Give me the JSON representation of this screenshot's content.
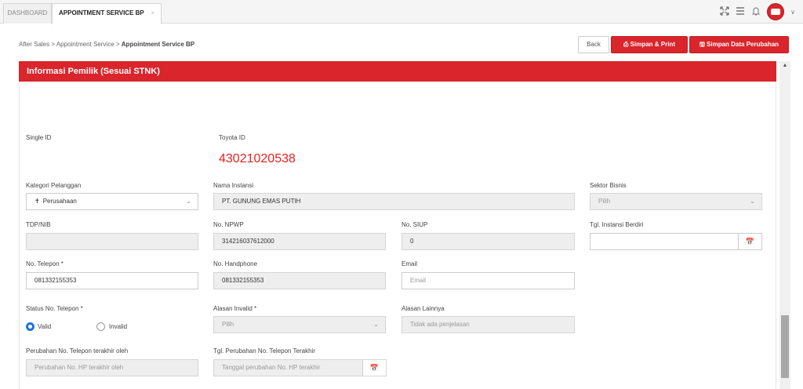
{
  "tabs": [
    {
      "label": "DASHBOARD",
      "active": false
    },
    {
      "label": "APPOINTMENT SERVICE BP",
      "active": true,
      "close": "×"
    }
  ],
  "topbar": {
    "icons": [
      "expand-icon",
      "menu-icon",
      "bell-icon",
      "avatar",
      "chevron-down-icon"
    ]
  },
  "breadcrumb": {
    "part1": "After Sales",
    "sep1": " > ",
    "part2": "Appointment Service",
    "sep2": " > ",
    "current": "Appointment Service BP"
  },
  "actions": {
    "back": "Back",
    "print": "Simpan & Print",
    "save": "Simpan Data Perubahan"
  },
  "section": {
    "title": "Informasi Pemilik (Sesuai STNK)"
  },
  "form": {
    "single_id_label": "Single ID",
    "toyota_id_label": "Toyota ID",
    "toyota_id_value": "43021020538",
    "kategori_label": "Kategori Pelanggan",
    "kategori_value": "Perusahaan",
    "nama_instansi_label": "Nama Instansi",
    "nama_instansi_value": "PT. GUNUNG EMAS PUTIH",
    "sektor_label": "Sektor Bisnis",
    "sektor_placeholder": "Pilih",
    "tdp_label": "TDP/NIB",
    "npwp_label": "No. NPWP",
    "npwp_value": "314216037612000",
    "siup_label": "No. SIUP",
    "siup_value": "0",
    "tgl_instansi_label": "Tgl. Instansi Berdiri",
    "telepon_label": "No. Telepon *",
    "telepon_value": "081332155353",
    "handphone_label": "No. Handphone",
    "handphone_value": "081332155353",
    "email_label": "Email",
    "email_placeholder": "Email",
    "status_label": "Status No. Telepon *",
    "status_valid": "Valid",
    "status_invalid": "Invalid",
    "status_selected": "Valid",
    "alasan_invalid_label": "Alasan Invalid *",
    "alasan_invalid_placeholder": "Pilih",
    "alasan_lainnya_label": "Alasan Lainnya",
    "alasan_lainnya_placeholder": "Tidak ada penjelasan",
    "perubahan_label": "Perubahan No. Telepon terakhir oleh",
    "perubahan_placeholder": "Perubahan No. HP terakhir oleh",
    "tgl_perubahan_label": "Tgl. Perubahan No. Telepon Terakhir",
    "tgl_perubahan_placeholder": "Tanggal perubahan No. HP terakhir"
  },
  "colors": {
    "accent": "#d9252b",
    "toyota_id": "#e8211d",
    "radio": "#1a73e8"
  }
}
